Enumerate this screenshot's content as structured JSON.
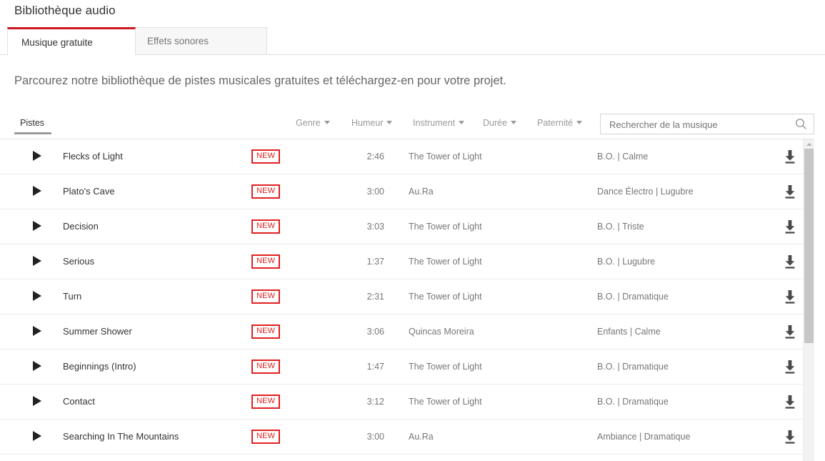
{
  "header": {
    "title": "Bibliothèque audio"
  },
  "tabs": [
    {
      "label": "Musique gratuite",
      "active": true
    },
    {
      "label": "Effets sonores",
      "active": false
    }
  ],
  "intro": {
    "text": "Parcourez notre bibliothèque de pistes musicales gratuites et téléchargez-en pour votre projet."
  },
  "columns": {
    "tracks_label": "Pistes",
    "filters": [
      {
        "label": "Genre"
      },
      {
        "label": "Humeur"
      },
      {
        "label": "Instrument"
      },
      {
        "label": "Durée"
      },
      {
        "label": "Paternité"
      }
    ]
  },
  "search": {
    "value": "",
    "placeholder": "Rechercher de la musique",
    "icon": "search-icon"
  },
  "icons": {
    "play": "play-icon",
    "download": "download-icon",
    "caret": "chevron-down-icon",
    "scroll_up": "scroll-up-arrow-icon"
  },
  "colors": {
    "accent_red": "#cc181e",
    "badge_red": "#e02020",
    "text_primary": "#333333",
    "text_secondary": "#777777",
    "border": "#ececec"
  },
  "badge_label": "NEW",
  "tracks": [
    {
      "title": "Flecks of Light",
      "badge": "NEW",
      "duration": "2:46",
      "artist": "The Tower of Light",
      "genre_mood": "B.O. | Calme"
    },
    {
      "title": "Plato's Cave",
      "badge": "NEW",
      "duration": "3:00",
      "artist": "Au.Ra",
      "genre_mood": "Dance Électro | Lugubre"
    },
    {
      "title": "Decision",
      "badge": "NEW",
      "duration": "3:03",
      "artist": "The Tower of Light",
      "genre_mood": "B.O. | Triste"
    },
    {
      "title": "Serious",
      "badge": "NEW",
      "duration": "1:37",
      "artist": "The Tower of Light",
      "genre_mood": "B.O. | Lugubre"
    },
    {
      "title": "Turn",
      "badge": "NEW",
      "duration": "2:31",
      "artist": "The Tower of Light",
      "genre_mood": "B.O. | Dramatique"
    },
    {
      "title": "Summer Shower",
      "badge": "NEW",
      "duration": "3:06",
      "artist": "Quincas Moreira",
      "genre_mood": "Enfants | Calme"
    },
    {
      "title": "Beginnings (Intro)",
      "badge": "NEW",
      "duration": "1:47",
      "artist": "The Tower of Light",
      "genre_mood": "B.O. | Dramatique"
    },
    {
      "title": "Contact",
      "badge": "NEW",
      "duration": "3:12",
      "artist": "The Tower of Light",
      "genre_mood": "B.O. | Dramatique"
    },
    {
      "title": "Searching In The Mountains",
      "badge": "NEW",
      "duration": "3:00",
      "artist": "Au.Ra",
      "genre_mood": "Ambiance | Dramatique"
    }
  ]
}
